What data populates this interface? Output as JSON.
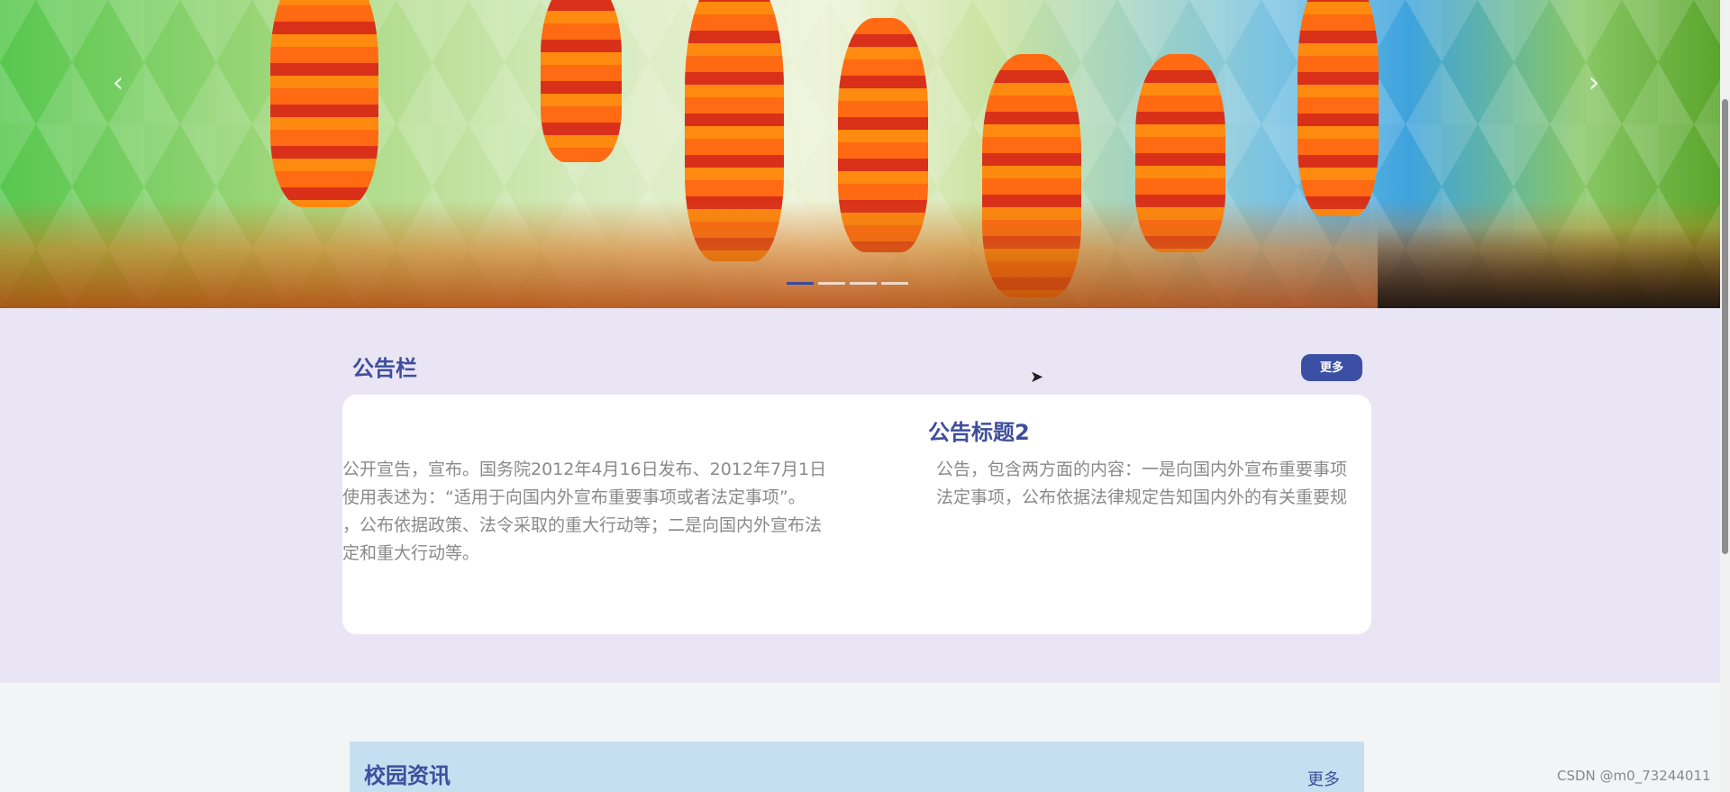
{
  "banner": {
    "prev_icon": "chevron-left-icon",
    "next_icon": "chevron-right-icon",
    "prev_glyph": "‹",
    "next_glyph": "›",
    "slide_count": 4,
    "active_slide": 1
  },
  "notice": {
    "title": "公告栏",
    "more_label": "更多",
    "slide_title": "公告标题2",
    "slide1_lines": [
      "公开宣告，宣布。国务院2012年4月16日发布、2012年7月1日",
      "使用表述为：“适用于向国内外宣布重要事项或者法定事项”。",
      "，公布依据政策、法令采取的重大行动等；二是向国内外宣布法",
      "定和重大行动等。"
    ],
    "slide2_lines": [
      "公告，包含两方面的内容：一是向国内外宣布重要事项",
      "法定事项，公布依据法律规定告知国内外的有关重要规"
    ]
  },
  "news": {
    "title": "校园资讯",
    "more_label": "更多"
  },
  "watermark": "CSDN @m0_73244011",
  "colors": {
    "accent": "#3f4e9c",
    "notice_bg": "#e9e5f4",
    "news_bar_bg": "#c5dff0"
  }
}
